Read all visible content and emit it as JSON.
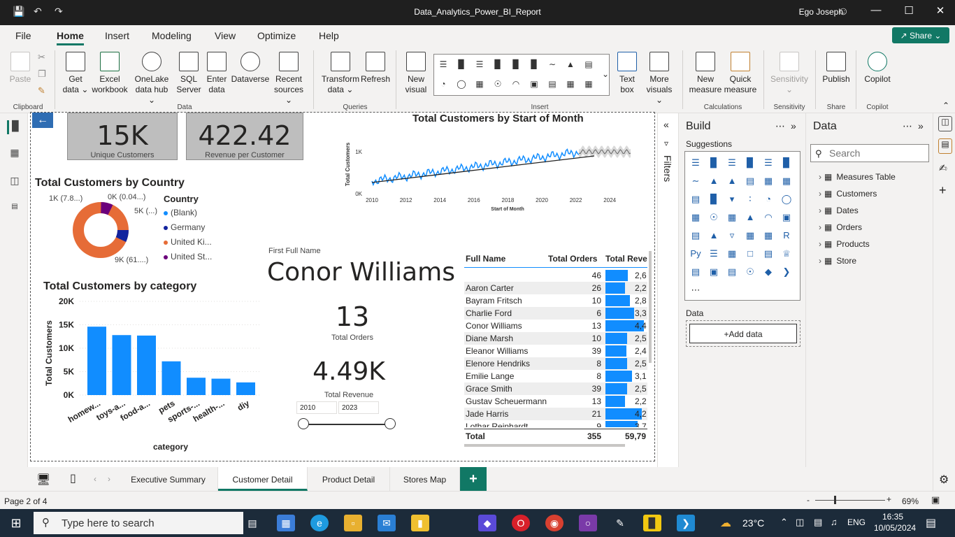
{
  "window": {
    "title": "Data_Analytics_Power_BI_Report",
    "user": "Ego Joseph"
  },
  "menu": {
    "file": "File",
    "home": "Home",
    "insert": "Insert",
    "modeling": "Modeling",
    "view": "View",
    "optimize": "Optimize",
    "help": "Help",
    "share": "Share"
  },
  "ribbon": {
    "paste": "Paste",
    "clipboard": "Clipboard",
    "get_data": [
      "Get",
      "data"
    ],
    "excel": [
      "Excel",
      "workbook"
    ],
    "onelake": [
      "OneLake",
      "data hub"
    ],
    "sql": [
      "SQL",
      "Server"
    ],
    "enter": [
      "Enter",
      "data"
    ],
    "dataverse": "Dataverse",
    "recent": [
      "Recent",
      "sources"
    ],
    "data_group": "Data",
    "transform": [
      "Transform",
      "data"
    ],
    "refresh": "Refresh",
    "queries_group": "Queries",
    "new_visual": [
      "New",
      "visual"
    ],
    "text_box": [
      "Text",
      "box"
    ],
    "more_visuals": [
      "More",
      "visuals"
    ],
    "insert_group": "Insert",
    "new_measure": [
      "New",
      "measure"
    ],
    "quick_measure": [
      "Quick",
      "measure"
    ],
    "calc_group": "Calculations",
    "sensitivity": "Sensitivity",
    "sensitivity_group": "Sensitivity",
    "publish": "Publish",
    "share_group": "Share",
    "copilot": "Copilot",
    "copilot_group": "Copilot"
  },
  "report": {
    "card1": {
      "value": "15K",
      "label": "Unique Customers"
    },
    "card2": {
      "value": "422.42",
      "label": "Revenue per Customer"
    },
    "country_chart": {
      "title": "Total Customers by Country",
      "legend_title": "Country",
      "labels": [
        "1K (7.8...)",
        "0K (0.04...)",
        "5K (...)",
        "9K (61....)"
      ],
      "legend": [
        {
          "name": "(Blank)",
          "color": "#118dff"
        },
        {
          "name": "Germany",
          "color": "#12239e"
        },
        {
          "name": "United Ki...",
          "color": "#e66c37"
        },
        {
          "name": "United St...",
          "color": "#6b007b"
        }
      ]
    },
    "month_chart": {
      "title": "Total Customers by Start of Month",
      "ylabel": "Total Customers",
      "xlabel": "Start of Month",
      "yticks": [
        "1K",
        "0K"
      ],
      "xticks": [
        "2010",
        "2012",
        "2014",
        "2016",
        "2018",
        "2020",
        "2022",
        "2024"
      ]
    },
    "selected": {
      "label": "First Full Name",
      "name": "Conor Williams",
      "orders": "13",
      "orders_label": "Total Orders",
      "revenue": "4.49K",
      "revenue_label": "Total Revenue"
    },
    "slider": {
      "from": "2010",
      "to": "2023"
    },
    "category_chart": {
      "title": "Total Customers by category",
      "ylabel": "Total Customers",
      "xlabel": "category",
      "yticks": [
        "20K",
        "15K",
        "10K",
        "5K",
        "0K"
      ],
      "categories": [
        "homew...",
        "toys-a...",
        "food-a...",
        "pets",
        "sports-...",
        "health-...",
        "diy"
      ],
      "values": [
        14600,
        12800,
        12700,
        7200,
        3700,
        3500,
        2700
      ]
    },
    "table": {
      "headers": [
        "Full Name",
        "Total Orders",
        "Total Reve"
      ],
      "rows": [
        {
          "name": "",
          "orders": "46",
          "rev": "2,6",
          "frac": 0.55
        },
        {
          "name": "Aaron Carter",
          "orders": "26",
          "rev": "2,2",
          "frac": 0.48
        },
        {
          "name": "Bayram Fritsch",
          "orders": "10",
          "rev": "2,8",
          "frac": 0.6
        },
        {
          "name": "Charlie Ford",
          "orders": "6",
          "rev": "3,3",
          "frac": 0.7
        },
        {
          "name": "Conor Williams",
          "orders": "13",
          "rev": "4,4",
          "frac": 0.95
        },
        {
          "name": "Diane Marsh",
          "orders": "10",
          "rev": "2,5",
          "frac": 0.53
        },
        {
          "name": "Eleanor Williams",
          "orders": "39",
          "rev": "2,4",
          "frac": 0.52
        },
        {
          "name": "Elenore Hendriks",
          "orders": "8",
          "rev": "2,5",
          "frac": 0.53
        },
        {
          "name": "Emilie Lange",
          "orders": "8",
          "rev": "3,1",
          "frac": 0.66
        },
        {
          "name": "Grace Smith",
          "orders": "39",
          "rev": "2,5",
          "frac": 0.53
        },
        {
          "name": "Gustav Scheuermann",
          "orders": "13",
          "rev": "2,2",
          "frac": 0.48
        },
        {
          "name": "Jade Harris",
          "orders": "21",
          "rev": "4,2",
          "frac": 0.9
        },
        {
          "name": "Lothar Reinhardt",
          "orders": "9",
          "rev": "3,7",
          "frac": 0.8
        }
      ],
      "total_label": "Total",
      "total_orders": "355",
      "total_rev": "59,79"
    }
  },
  "build": {
    "title": "Build",
    "suggestions": "Suggestions",
    "data_label": "Data",
    "add_data": "+Add data"
  },
  "datapane": {
    "title": "Data",
    "search_placeholder": "Search",
    "tables": [
      "Measures Table",
      "Customers",
      "Dates",
      "Orders",
      "Products",
      "Store"
    ]
  },
  "filters": {
    "label": "Filters"
  },
  "pages": {
    "tabs": [
      "Executive Summary",
      "Customer Detail",
      "Product Detail",
      "Stores Map"
    ],
    "add": "+"
  },
  "status": {
    "page": "Page 2 of 4",
    "zoom": "69%"
  },
  "taskbar": {
    "search": "Type here to search",
    "weather": "23°C",
    "lang": "ENG",
    "time": "16:35",
    "date": "10/05/2024"
  }
}
